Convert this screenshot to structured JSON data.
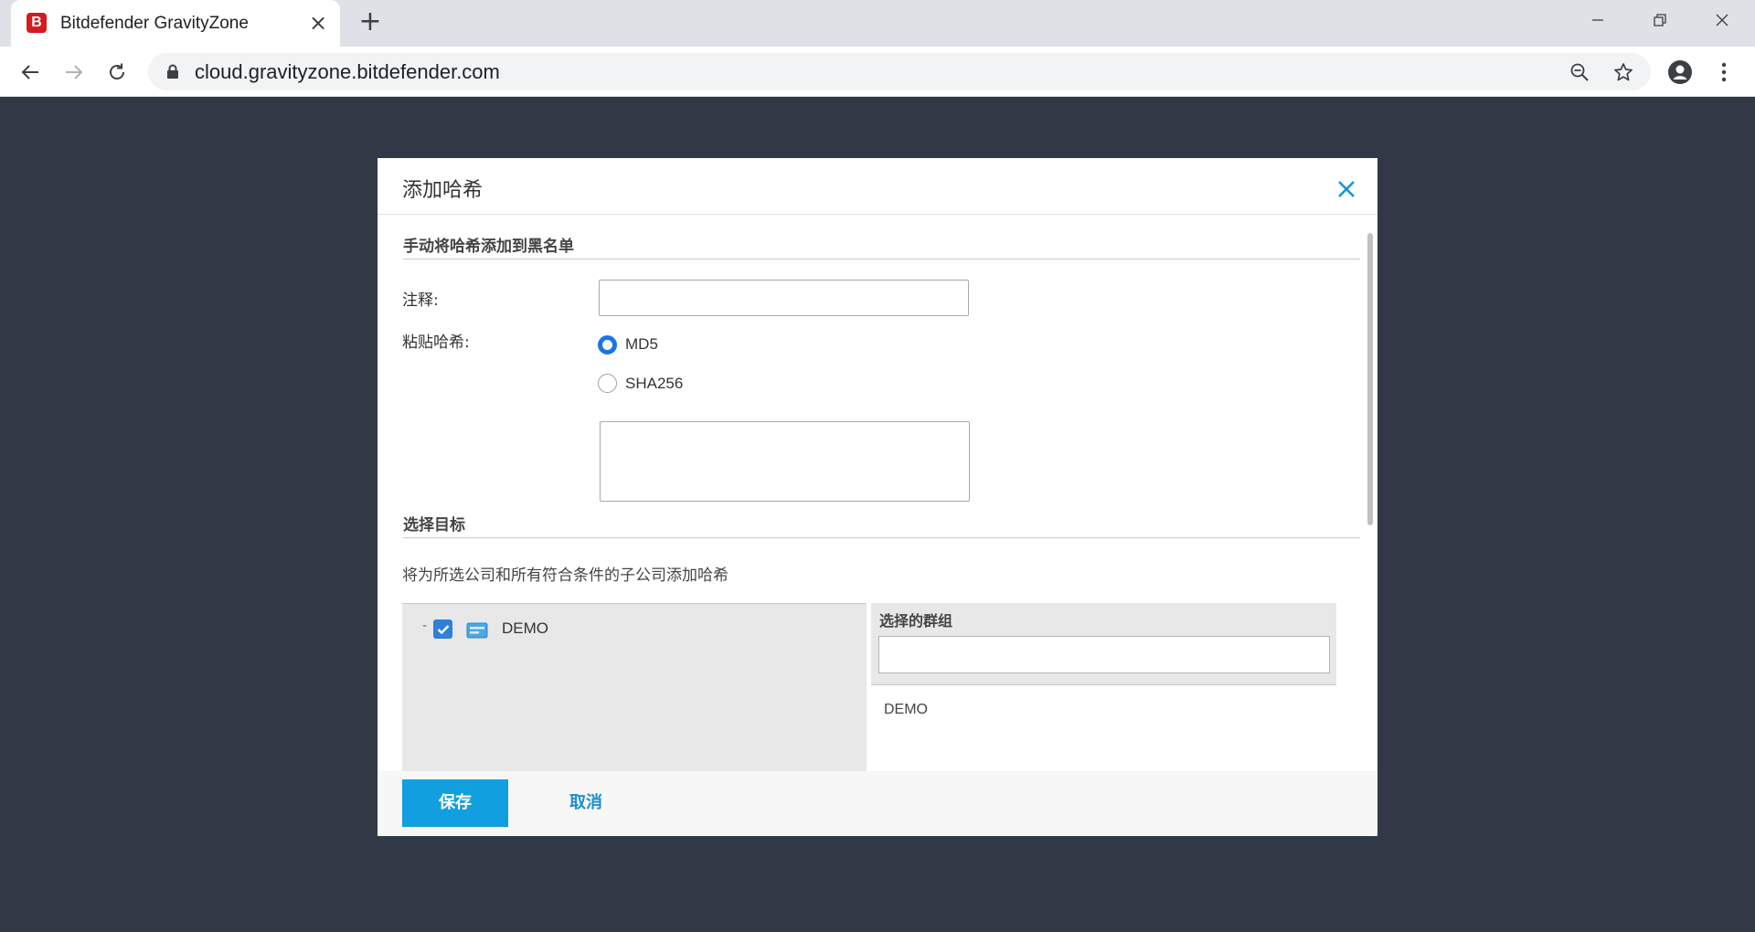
{
  "browser": {
    "tab_title": "Bitdefender GravityZone",
    "favicon_letter": "B",
    "url": "cloud.gravityzone.bitdefender.com",
    "icons": [
      "back-icon",
      "forward-icon",
      "reload-icon",
      "lock-icon",
      "zoom-out-icon",
      "star-icon",
      "account-icon",
      "menu-icon",
      "minimize-icon",
      "restore-icon",
      "close-window-icon"
    ]
  },
  "modal": {
    "title": "添加哈希",
    "section_manual": "手动将哈希添加到黑名单",
    "comment_label": "注释:",
    "comment_value": "",
    "hash_label": "粘贴哈希:",
    "hash_types": [
      {
        "label": "MD5",
        "selected": true
      },
      {
        "label": "SHA256",
        "selected": false
      }
    ],
    "hash_value": "",
    "section_target": "选择目标",
    "target_desc": "将为所选公司和所有符合条件的子公司添加哈希",
    "tree": {
      "label": "DEMO",
      "checked": true
    },
    "selected_groups": {
      "title": "选择的群组",
      "filter_value": "",
      "items": [
        "DEMO"
      ]
    },
    "save_label": "保存",
    "cancel_label": "取消"
  },
  "colors": {
    "accent": "#119fe0",
    "backdrop": "#303945",
    "radio_selected": "#1a73e8"
  }
}
